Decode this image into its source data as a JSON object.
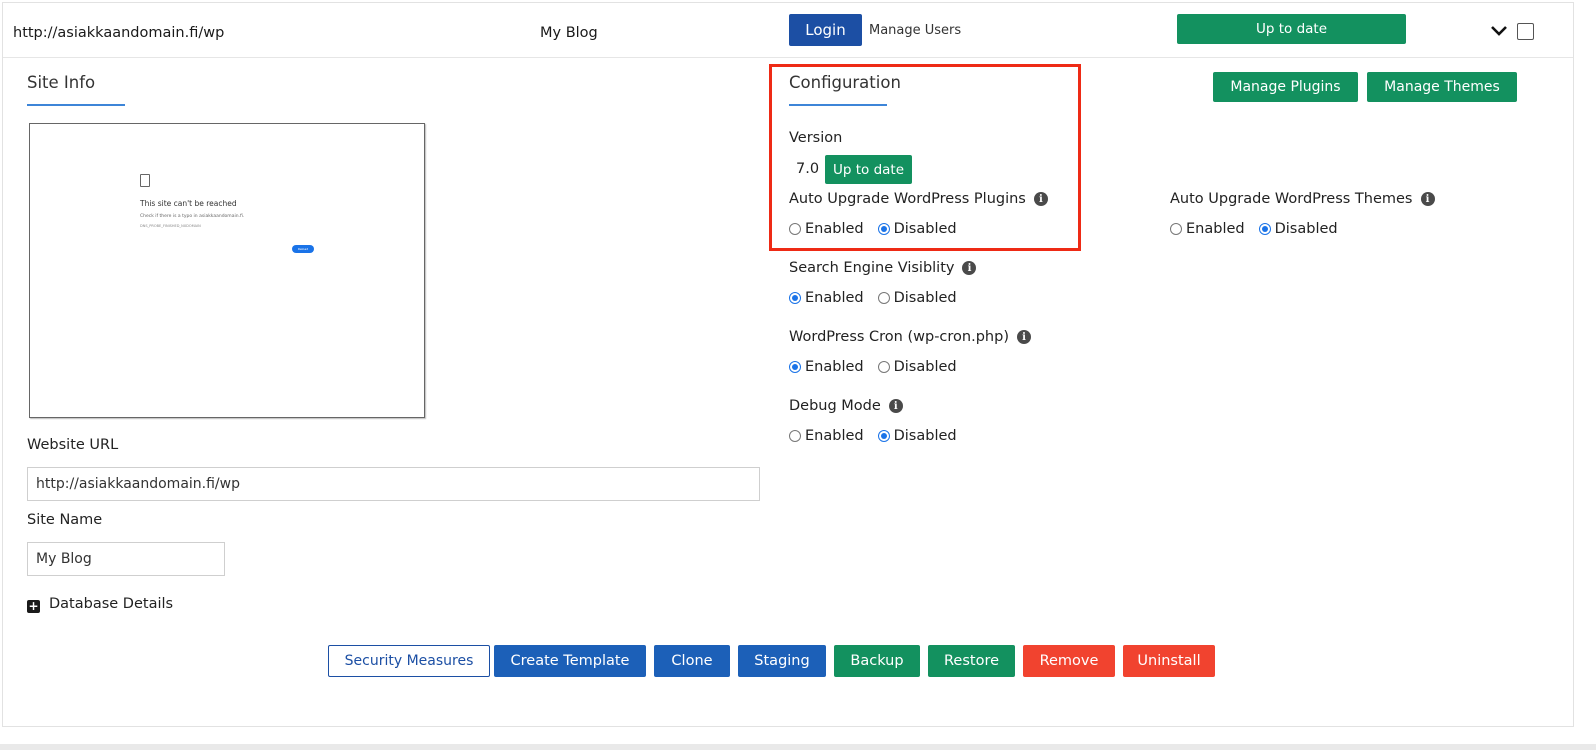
{
  "header": {
    "site_url": "http://asiakkaandomain.fi/wp",
    "site_name": "My Blog",
    "login_label": "Login",
    "manage_users_label": "Manage Users",
    "status_label": "Up to date"
  },
  "site_info": {
    "title": "Site Info",
    "preview": {
      "title": "This site can't be reached",
      "line": "Check if there is a typo in asiakkaandomain.fi.",
      "code": "DNS_PROBE_FINISHED_NXDOMAIN",
      "button": "Reload"
    },
    "website_url_label": "Website URL",
    "website_url_value": "http://asiakkaandomain.fi/wp",
    "site_name_label": "Site Name",
    "site_name_value": "My Blog",
    "database_details_label": "Database Details"
  },
  "configuration": {
    "title": "Configuration",
    "version_label": "Version",
    "version_value": "7.0",
    "version_status": "Up to date",
    "manage_plugins_label": "Manage Plugins",
    "manage_themes_label": "Manage Themes",
    "auto_upgrade_plugins": {
      "label": "Auto Upgrade WordPress Plugins",
      "enabled_label": "Enabled",
      "disabled_label": "Disabled",
      "selected": "Disabled"
    },
    "auto_upgrade_themes": {
      "label": "Auto Upgrade WordPress Themes",
      "enabled_label": "Enabled",
      "disabled_label": "Disabled",
      "selected": "Disabled"
    },
    "search_engine": {
      "label": "Search Engine Visiblity",
      "enabled_label": "Enabled",
      "disabled_label": "Disabled",
      "selected": "Enabled"
    },
    "wp_cron": {
      "label": "WordPress Cron (wp-cron.php)",
      "enabled_label": "Enabled",
      "disabled_label": "Disabled",
      "selected": "Enabled"
    },
    "debug_mode": {
      "label": "Debug Mode",
      "enabled_label": "Enabled",
      "disabled_label": "Disabled",
      "selected": "Disabled"
    }
  },
  "actions": {
    "security_measures": "Security Measures",
    "create_template": "Create Template",
    "clone": "Clone",
    "staging": "Staging",
    "backup": "Backup",
    "restore": "Restore",
    "remove": "Remove",
    "uninstall": "Uninstall"
  },
  "icons": {
    "info": "info-icon",
    "chevron": "chevron-down-icon",
    "expand": "plus-square-icon",
    "document": "document-icon"
  },
  "colors": {
    "primary_blue": "#1c4fa4",
    "button_blue": "#1c60b8",
    "green": "#13915f",
    "red": "#f1432f",
    "highlight": "#ee2a15",
    "radio": "#1a73e8"
  }
}
